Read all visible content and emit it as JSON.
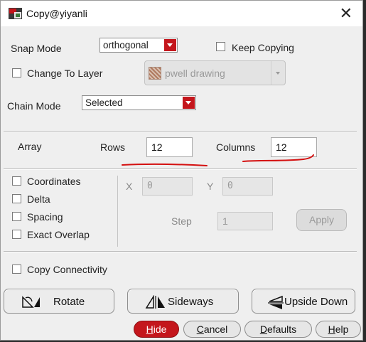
{
  "window": {
    "title": "Copy@yiyanli",
    "close_glyph": "✕"
  },
  "snap": {
    "label": "Snap Mode",
    "value": "orthogonal"
  },
  "keep_copying": {
    "label": "Keep Copying",
    "checked": false
  },
  "change_layer": {
    "label": "Change To Layer",
    "checked": false,
    "layer_value": "pwell drawing"
  },
  "chain": {
    "label": "Chain Mode",
    "value": "Selected"
  },
  "array": {
    "label": "Array",
    "rows_label": "Rows",
    "rows_value": "12",
    "columns_label": "Columns",
    "columns_value": "12"
  },
  "options": {
    "coordinates": "Coordinates",
    "delta": "Delta",
    "spacing": "Spacing",
    "exact_overlap": "Exact Overlap"
  },
  "offsets": {
    "x_label": "X",
    "x_value": "0",
    "y_label": "Y",
    "y_value": "0",
    "step_label": "Step",
    "step_value": "1",
    "apply_label": "Apply"
  },
  "copy_connectivity": {
    "label": "Copy Connectivity",
    "checked": false
  },
  "transforms": {
    "rotate": "Rotate",
    "sideways": "Sideways",
    "upside_down": "Upside Down"
  },
  "footer": {
    "hide": {
      "first": "H",
      "rest": "ide"
    },
    "cancel": {
      "first": "C",
      "rest": "ancel"
    },
    "defaults": {
      "first": "D",
      "rest": "efaults"
    },
    "help": {
      "first": "H",
      "rest": "elp"
    }
  },
  "colors": {
    "accent_red": "#c4161c",
    "annotation_red": "#d41010",
    "background": "#efefef"
  },
  "icons": {
    "app": "layout-copy-icon",
    "rotate": "rotate-icon",
    "sideways": "flip-sideways-icon",
    "upside_down": "flip-upside-down-icon"
  }
}
